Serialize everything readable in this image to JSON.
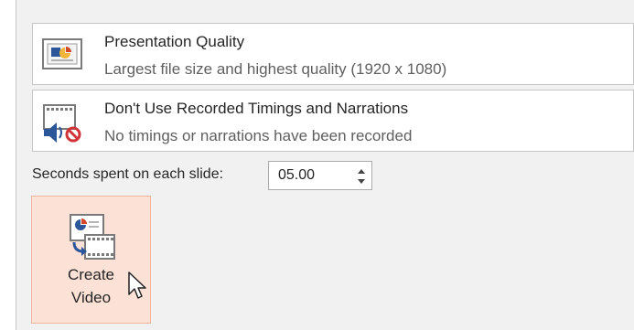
{
  "quality_option": {
    "title": "Presentation Quality",
    "subtitle": "Largest file size and highest quality (1920 x 1080)",
    "icon": "presentation-quality-icon"
  },
  "timings_option": {
    "title": "Don't Use Recorded Timings and Narrations",
    "subtitle": "No timings or narrations have been recorded",
    "icon": "no-narration-icon"
  },
  "seconds": {
    "label": "Seconds spent on each slide:",
    "value": "05.00"
  },
  "create_button": {
    "line1": "Create",
    "line2": "Video",
    "icon": "create-video-icon"
  },
  "colors": {
    "accent_orange": "#d24726",
    "button_hover_bg": "#fbe1d6",
    "panel_bg": "#f1f1f1",
    "speaker_blue": "#2b579a",
    "no_red": "#d13438"
  }
}
